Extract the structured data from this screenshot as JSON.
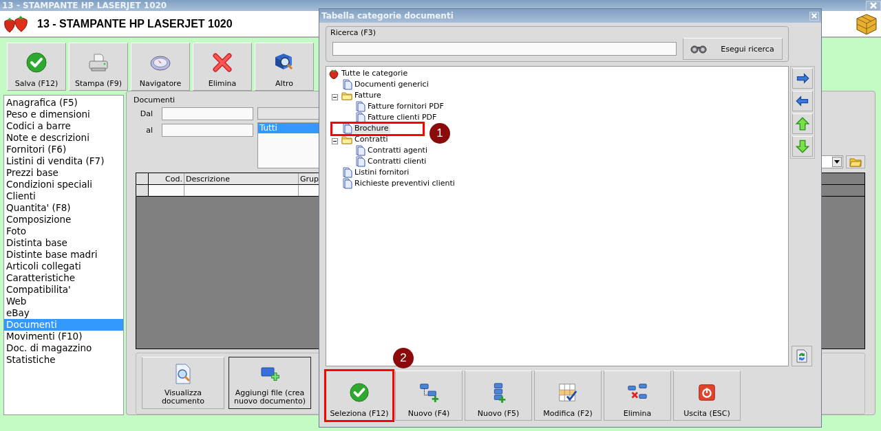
{
  "window": {
    "title": "13 - STAMPANTE HP LASERJET 1020"
  },
  "header": {
    "title": "13 - STAMPANTE HP LASERJET 1020"
  },
  "toolbar": [
    {
      "label": "Salva (F12)",
      "kind": "save"
    },
    {
      "label": "Stampa (F9)",
      "kind": "print"
    },
    {
      "label": "Navigatore",
      "kind": "compass"
    },
    {
      "label": "Elimina",
      "kind": "delete"
    },
    {
      "label": "Altro",
      "kind": "book"
    }
  ],
  "sidebar": {
    "items": [
      {
        "label": "Anagrafica (F5)",
        "selected": false
      },
      {
        "label": "Peso e dimensioni",
        "selected": false
      },
      {
        "label": "Codici a barre",
        "selected": false
      },
      {
        "label": "Note e descrizioni",
        "selected": false
      },
      {
        "label": "Fornitori (F6)",
        "selected": false
      },
      {
        "label": "Listini di vendita (F7)",
        "selected": false
      },
      {
        "label": "Prezzi base",
        "selected": false
      },
      {
        "label": "Condizioni speciali",
        "selected": false
      },
      {
        "label": "Clienti",
        "selected": false
      },
      {
        "label": "Quantita' (F8)",
        "selected": false
      },
      {
        "label": "Composizione",
        "selected": false
      },
      {
        "label": "Foto",
        "selected": false
      },
      {
        "label": "Distinta base",
        "selected": false
      },
      {
        "label": "Distinte base madri",
        "selected": false
      },
      {
        "label": "Articoli collegati",
        "selected": false
      },
      {
        "label": "Caratteristiche",
        "selected": false
      },
      {
        "label": "Compatibilita'",
        "selected": false
      },
      {
        "label": "Web",
        "selected": false
      },
      {
        "label": "eBay",
        "selected": false
      },
      {
        "label": "Documenti",
        "selected": true
      },
      {
        "label": "Movimenti (F10)",
        "selected": false
      },
      {
        "label": "Doc. di magazzino",
        "selected": false
      },
      {
        "label": "Statistiche",
        "selected": false
      }
    ]
  },
  "documents": {
    "title": "Documenti",
    "from_label": "Dal",
    "to_label": "al",
    "list": [
      {
        "label": "Tutti",
        "selected": true
      }
    ],
    "table": {
      "columns": [
        "Cod.",
        "Descrizione",
        "Grup"
      ]
    },
    "actions": [
      {
        "label": "Visualizza documento",
        "kind": "view",
        "focused": false
      },
      {
        "label": "Aggiungi file (crea nuovo documento)",
        "kind": "add",
        "focused": true
      }
    ]
  },
  "dialog": {
    "title": "Tabella categorie documenti",
    "search": {
      "title": "Ricerca (F3)",
      "button": "Esegui ricerca"
    },
    "tree": [
      {
        "label": "Tutte le categorie",
        "kind": "root",
        "selected": false,
        "children": [
          {
            "label": "Documenti generici",
            "kind": "document",
            "selected": false
          },
          {
            "label": "Fatture",
            "kind": "folder",
            "selected": false,
            "expanded": true,
            "children": [
              {
                "label": "Fatture fornitori PDF",
                "kind": "document",
                "selected": false
              },
              {
                "label": "Fatture clienti PDF",
                "kind": "document",
                "selected": false
              }
            ]
          },
          {
            "label": "Brochure",
            "kind": "document",
            "selected": true,
            "callout": "1"
          },
          {
            "label": "Contratti",
            "kind": "folder",
            "selected": false,
            "expanded": true,
            "children": [
              {
                "label": "Contratti agenti",
                "kind": "document",
                "selected": false
              },
              {
                "label": "Contratti clienti",
                "kind": "document",
                "selected": false
              }
            ]
          },
          {
            "label": "Listini fornitori",
            "kind": "document",
            "selected": false
          },
          {
            "label": "Richieste preventivi clienti",
            "kind": "document",
            "selected": false
          }
        ]
      }
    ],
    "side_buttons": [
      {
        "kind": "right"
      },
      {
        "kind": "left"
      },
      {
        "kind": "up"
      },
      {
        "kind": "down"
      }
    ],
    "buttons": [
      {
        "label": "Seleziona (F12)",
        "kind": "select",
        "callout": "2"
      },
      {
        "label": "Nuovo (F4)",
        "kind": "new-child"
      },
      {
        "label": "Nuovo (F5)",
        "kind": "new-sibling"
      },
      {
        "label": "Modifica (F2)",
        "kind": "edit"
      },
      {
        "label": "Elimina",
        "kind": "delete"
      },
      {
        "label": "Uscita (ESC)",
        "kind": "exit"
      }
    ]
  }
}
